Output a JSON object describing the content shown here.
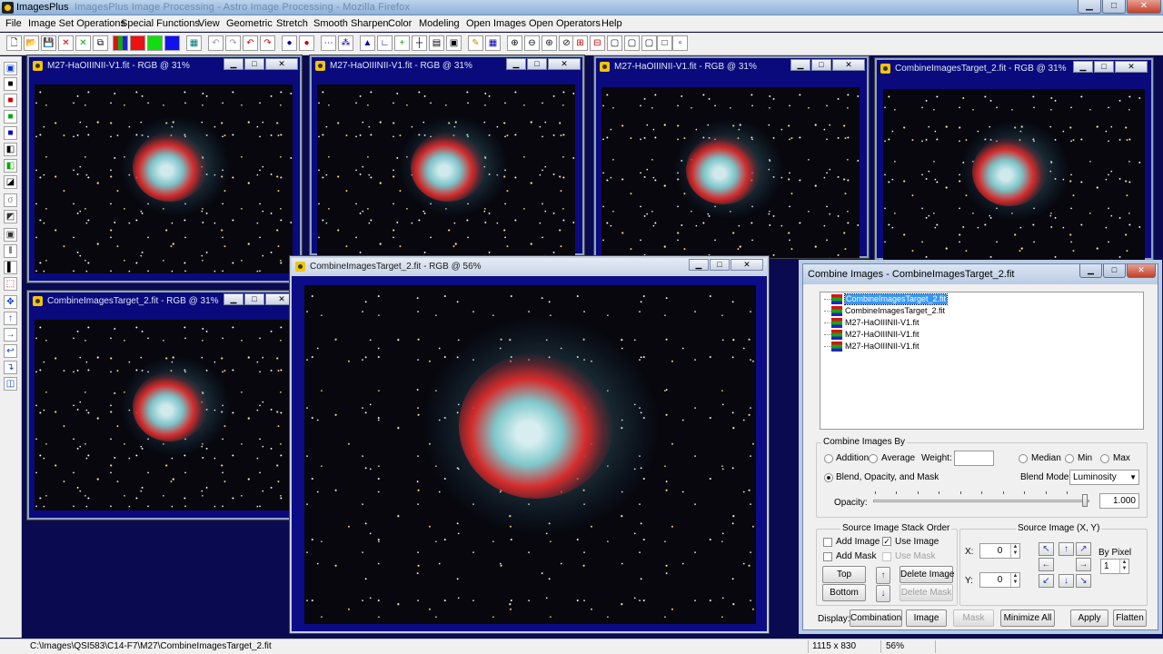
{
  "app": {
    "title": "ImagesPlus",
    "ghost_text": "ImagesPlus Image Processing - Astro Image Processing - Mozilla Firefox"
  },
  "menu": [
    "File",
    "Image Set Operations",
    "Special Functions",
    "View",
    "Geometric",
    "Stretch",
    "Smooth Sharpen",
    "Color",
    "Modeling",
    "Open Images",
    "Open Operators",
    "Help"
  ],
  "window_buttons": {
    "minimize": "▁",
    "restore": "□",
    "close": "✕"
  },
  "image_windows": [
    {
      "title": "M27-HaOIIINII-V1.fit - RGB @ 31%"
    },
    {
      "title": "M27-HaOIIINII-V1.fit - RGB @ 31%"
    },
    {
      "title": "M27-HaOIIINII-V1.fit - RGB @ 31%"
    },
    {
      "title": "CombineImagesTarget_2.fit - RGB @ 31%"
    },
    {
      "title": "CombineImagesTarget_2.fit - RGB @ 31%"
    },
    {
      "title": "CombineImagesTarget_2.fit - RGB @ 56%"
    }
  ],
  "combine": {
    "title": "Combine Images - CombineImagesTarget_2.fit",
    "list": [
      "CombineImagesTarget_2.fit",
      "CombineImagesTarget_2.fit",
      "M27-HaOIIINII-V1.fit",
      "M27-HaOIIINII-V1.fit",
      "M27-HaOIIINII-V1.fit"
    ],
    "combine_by": {
      "label": "Combine Images By",
      "addition": "Addition",
      "average": "Average",
      "weight_label": "Weight:",
      "weight_value": "",
      "median": "Median",
      "min": "Min",
      "max": "Max",
      "blend": "Blend, Opacity, and Mask",
      "blend_mode_label": "Blend Mode:",
      "blend_mode_value": "Luminosity",
      "opacity_label": "Opacity:",
      "opacity_value": "1.000",
      "opacity_fraction": 1.0
    },
    "stack": {
      "label": "Source Image Stack Order",
      "add_image": "Add Image",
      "use_image": "Use Image",
      "use_image_checked": "✓",
      "add_mask": "Add Mask",
      "use_mask": "Use Mask",
      "top": "Top",
      "bottom": "Bottom",
      "up": "↑",
      "down": "↓",
      "delete_image": "Delete Image",
      "delete_mask": "Delete Mask"
    },
    "source": {
      "label": "Source Image (X, Y)",
      "x_label": "X:",
      "x_value": "0",
      "y_label": "Y:",
      "y_value": "0",
      "by_pixel_label": "By Pixel",
      "by_pixel_value": "1",
      "arrows": [
        "↖",
        "↑",
        "↗",
        "←",
        "→",
        "↙",
        "↓",
        "↘"
      ]
    },
    "display": {
      "label": "Display:",
      "combination": "Combination",
      "image": "Image",
      "mask": "Mask",
      "minimize_all": "Minimize All",
      "apply": "Apply",
      "flatten": "Flatten"
    }
  },
  "status": {
    "path": "C:\\Images\\QSI583\\C14-F7\\M27\\CombineImagesTarget_2.fit",
    "size": "1115 x 830",
    "zoom": "56%"
  }
}
